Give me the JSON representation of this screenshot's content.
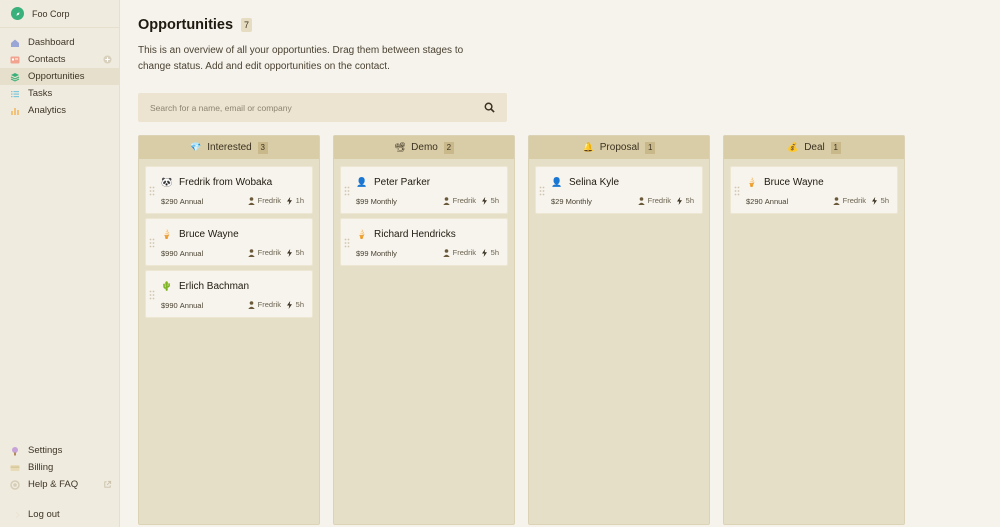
{
  "brand": {
    "name": "Foo Corp"
  },
  "nav": {
    "main": [
      {
        "label": "Dashboard",
        "icon": "home-icon"
      },
      {
        "label": "Contacts",
        "icon": "contacts-icon"
      },
      {
        "label": "Opportunities",
        "icon": "layers-icon"
      },
      {
        "label": "Tasks",
        "icon": "list-icon"
      },
      {
        "label": "Analytics",
        "icon": "chart-icon"
      }
    ],
    "bottom": [
      {
        "label": "Settings",
        "icon": "settings-icon"
      },
      {
        "label": "Billing",
        "icon": "billing-icon"
      },
      {
        "label": "Help & FAQ",
        "icon": "help-icon"
      }
    ],
    "logout": "Log out"
  },
  "page": {
    "title": "Opportunities",
    "count": "7",
    "description": "This is an overview of all your opportunties. Drag them between stages to change status. Add and edit opportunities on the contact."
  },
  "search": {
    "placeholder": "Search for a name, email or company"
  },
  "columns": [
    {
      "name": "Interested",
      "count": "3",
      "emoji": "💎",
      "cards": [
        {
          "name": "Fredrik from Wobaka",
          "amount": "$290",
          "period": "Annual",
          "owner": "Fredrik",
          "age": "1h",
          "avatar": "🐼"
        },
        {
          "name": "Bruce Wayne",
          "amount": "$990",
          "period": "Annual",
          "owner": "Fredrik",
          "age": "5h",
          "avatar": "🍦"
        },
        {
          "name": "Erlich Bachman",
          "amount": "$990",
          "period": "Annual",
          "owner": "Fredrik",
          "age": "5h",
          "avatar": "🌵"
        }
      ]
    },
    {
      "name": "Demo",
      "count": "2",
      "emoji": "📽",
      "cards": [
        {
          "name": "Peter Parker",
          "amount": "$99",
          "period": "Monthly",
          "owner": "Fredrik",
          "age": "5h",
          "avatar": "👤"
        },
        {
          "name": "Richard Hendricks",
          "amount": "$99",
          "period": "Monthly",
          "owner": "Fredrik",
          "age": "5h",
          "avatar": "🍦"
        }
      ]
    },
    {
      "name": "Proposal",
      "count": "1",
      "emoji": "🔔",
      "cards": [
        {
          "name": "Selina Kyle",
          "amount": "$29",
          "period": "Monthly",
          "owner": "Fredrik",
          "age": "5h",
          "avatar": "👤"
        }
      ]
    },
    {
      "name": "Deal",
      "count": "1",
      "emoji": "💰",
      "cards": [
        {
          "name": "Bruce Wayne",
          "amount": "$290",
          "period": "Annual",
          "owner": "Fredrik",
          "age": "5h",
          "avatar": "🍦"
        }
      ]
    }
  ],
  "colors": {
    "accent": "#3ab07a",
    "sidebar": "#f0ebdf",
    "column": "#e6dfc8",
    "column_header": "#d9cda8"
  }
}
